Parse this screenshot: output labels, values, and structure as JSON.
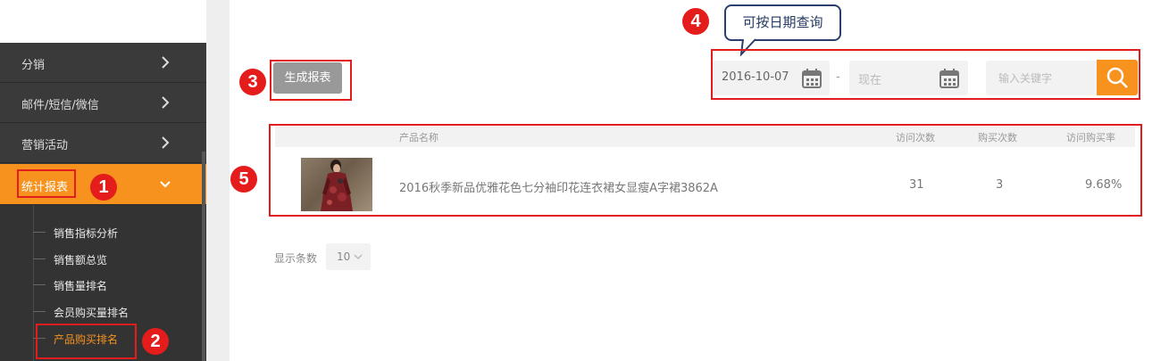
{
  "sidebar": {
    "items": [
      {
        "label": "分销",
        "icon": "chevron-right-icon"
      },
      {
        "label": "邮件/短信/微信",
        "icon": "chevron-right-icon"
      },
      {
        "label": "营销活动",
        "icon": "chevron-right-icon"
      },
      {
        "label": "统计报表",
        "icon": "chevron-down-icon",
        "active": true
      }
    ],
    "submenu": [
      {
        "label": "销售指标分析"
      },
      {
        "label": "销售额总览"
      },
      {
        "label": "销售量排名"
      },
      {
        "label": "会员购买量排名"
      },
      {
        "label": "产品购买排名",
        "selected": true
      }
    ]
  },
  "toolbar": {
    "generate_label": "生成报表",
    "start_date": "2016-10-07",
    "end_date": "现在",
    "separator": "-",
    "search_placeholder": "输入关键字"
  },
  "callout": {
    "text": "可按日期查询"
  },
  "table": {
    "columns": [
      "产品名称",
      "访问次数",
      "购买次数",
      "访问购买率"
    ],
    "rows": [
      {
        "name": "2016秋季新品优雅花色七分袖印花连衣裙女显瘦A字裙3862A",
        "visits": "31",
        "purchases": "3",
        "rate": "9.68%"
      }
    ]
  },
  "pagination": {
    "rows_label": "显示条数",
    "rows_value": "10"
  },
  "badges": [
    "1",
    "2",
    "3",
    "4",
    "5"
  ],
  "colors": {
    "accent": "#f7921e",
    "annotation_red": "#e21d1d",
    "sidebar_bg": "#3a3a3a",
    "callout_border": "#2a3f6b"
  }
}
